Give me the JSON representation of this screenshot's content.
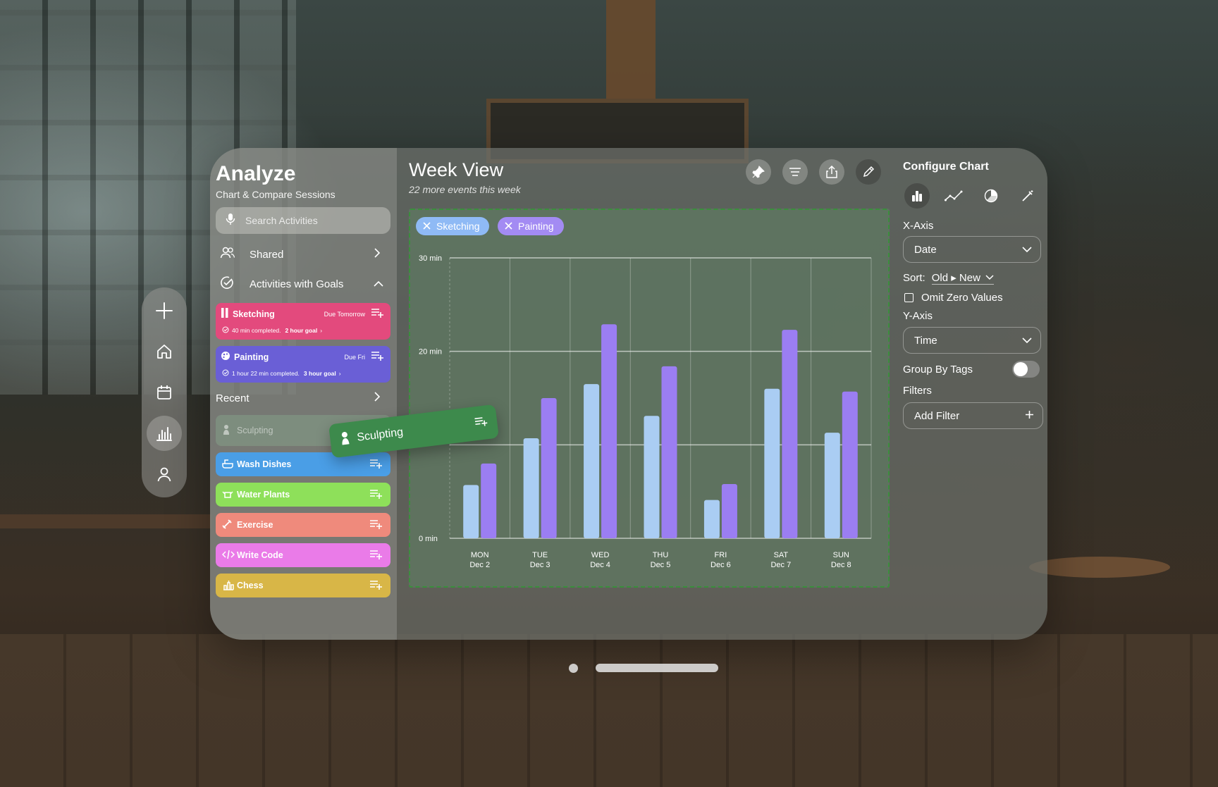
{
  "sidebar": {
    "title": "Analyze",
    "subtitle": "Chart & Compare Sessions",
    "search_placeholder": "Search Activities",
    "nav": [
      {
        "label": "Shared"
      },
      {
        "label": "Activities with Goals"
      }
    ],
    "goal_cards": [
      {
        "name": "Sketching",
        "due": "Due Tomorrow",
        "completed": "40 min completed.",
        "goal": "2 hour goal",
        "color": "#e34a7d"
      },
      {
        "name": "Painting",
        "due": "Due Fri",
        "completed": "1 hour 22 min completed.",
        "goal": "3 hour goal",
        "color": "#6a5fd6"
      }
    ],
    "recent_label": "Recent",
    "recent": [
      {
        "name": "Sculpting",
        "color": "#7fa88a"
      },
      {
        "name": "Wash Dishes",
        "color": "#4a9ee6"
      },
      {
        "name": "Water Plants",
        "color": "#8ee05a"
      },
      {
        "name": "Exercise",
        "color": "#ef8a7c"
      },
      {
        "name": "Write Code",
        "color": "#ea7be8"
      },
      {
        "name": "Chess",
        "color": "#d8b647"
      }
    ],
    "drag_chip": "Sculpting"
  },
  "main": {
    "title": "Week View",
    "subtitle": "22 more events this week",
    "tags": [
      {
        "label": "Sketching",
        "color": "#8fbaf5"
      },
      {
        "label": "Painting",
        "color": "#a38bf3"
      }
    ]
  },
  "chart_data": {
    "type": "bar",
    "categories": [
      "MON",
      "TUE",
      "WED",
      "THU",
      "FRI",
      "SAT",
      "SUN"
    ],
    "dates": [
      "Dec 2",
      "Dec 3",
      "Dec 4",
      "Dec 5",
      "Dec 6",
      "Dec 7",
      "Dec 8"
    ],
    "series": [
      {
        "name": "Sketching",
        "values": [
          5.7,
          10.7,
          16.5,
          13.1,
          4.1,
          16.0,
          11.3
        ],
        "color": "#aacdf3"
      },
      {
        "name": "Painting",
        "values": [
          8.0,
          15.0,
          22.9,
          18.4,
          5.8,
          22.3,
          15.7
        ],
        "color": "#9b7ef2"
      }
    ],
    "ytick_labels": [
      "0 min",
      "20 min",
      "30 min"
    ],
    "ylim": [
      0,
      30
    ],
    "grid": true
  },
  "config": {
    "title": "Configure Chart",
    "chart_types": [
      "bar-chart-icon",
      "line-chart-icon",
      "pie-chart-icon",
      "wand-icon"
    ],
    "xaxis_label": "X-Axis",
    "xaxis_value": "Date",
    "sort_label": "Sort:",
    "sort_value": "Old ▸ New",
    "omit_zero": "Omit Zero Values",
    "yaxis_label": "Y-Axis",
    "yaxis_value": "Time",
    "group_by_tags": "Group By Tags",
    "filters_label": "Filters",
    "add_filter": "Add Filter"
  }
}
